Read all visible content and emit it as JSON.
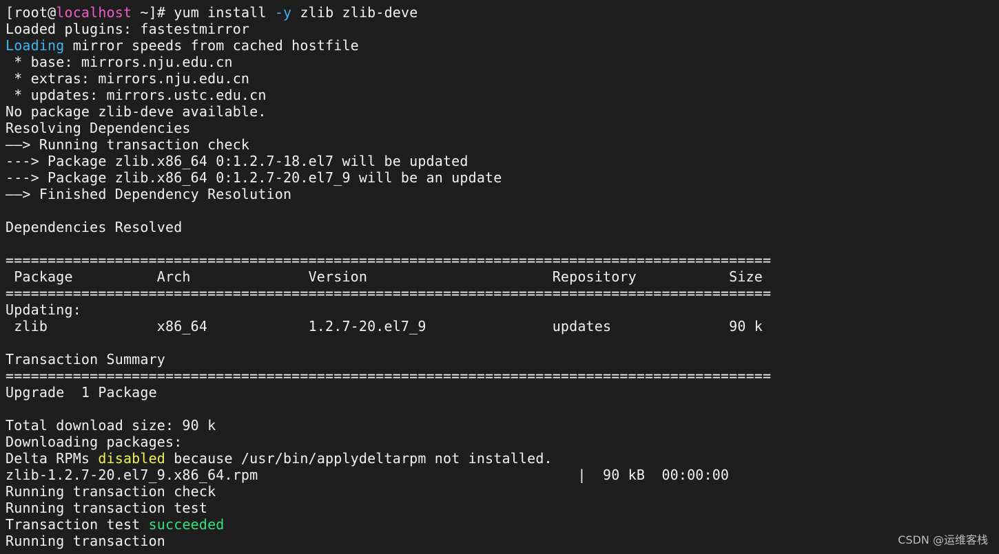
{
  "terminal": {
    "prompt": {
      "open_bracket": "[",
      "user": "root",
      "at": "@",
      "host": "localhost",
      "path_and_symbol": " ~]# ",
      "cmd_before_flag": "yum install ",
      "flag": "-y",
      "cmd_after_flag": " zlib zlib-deve"
    },
    "lines": {
      "l2": "Loaded plugins: fastestmirror",
      "l3_highlight": "Loading",
      "l3_rest": " mirror speeds from cached hostfile",
      "l4": " * base: mirrors.nju.edu.cn",
      "l5": " * extras: mirrors.nju.edu.cn",
      "l6": " * updates: mirrors.ustc.edu.cn",
      "l7": "No package zlib-deve available.",
      "l8": "Resolving Dependencies",
      "l9": "——> Running transaction check",
      "l10": "---> Package zlib.x86_64 0:1.2.7-18.el7 will be updated",
      "l11": "---> Package zlib.x86_64 0:1.2.7-20.el7_9 will be an update",
      "l12": "——> Finished Dependency Resolution",
      "l13": "",
      "l14": "Dependencies Resolved",
      "l15": "",
      "l16": "===========================================================================================",
      "l17": " Package          Arch              Version                      Repository           Size",
      "l18": "===========================================================================================",
      "l19": "Updating:",
      "l20": " zlib             x86_64            1.2.7-20.el7_9               updates              90 k",
      "l21": "",
      "l22": "Transaction Summary",
      "l23": "===========================================================================================",
      "l24": "Upgrade  1 Package",
      "l25": "",
      "l26": "Total download size: 90 k",
      "l27": "Downloading packages:",
      "l28_before": "Delta RPMs ",
      "l28_highlight": "disabled",
      "l28_after": " because /usr/bin/applydeltarpm not installed.",
      "l29": "zlib-1.2.7-20.el7_9.x86_64.rpm                                      |  90 kB  00:00:00",
      "l30": "Running transaction check",
      "l31": "Running transaction test",
      "l32_before": "Transaction test ",
      "l32_highlight": "succeeded",
      "l33": "Running transaction"
    }
  },
  "watermark": "CSDN @运维客栈",
  "colors": {
    "background": "#1e1e1e",
    "text": "#f2f2f2",
    "hostname": "#f05aca",
    "flag": "#3fb6f0",
    "loading": "#3fb6f0",
    "disabled": "#f0f050",
    "succeeded": "#33e07a"
  }
}
